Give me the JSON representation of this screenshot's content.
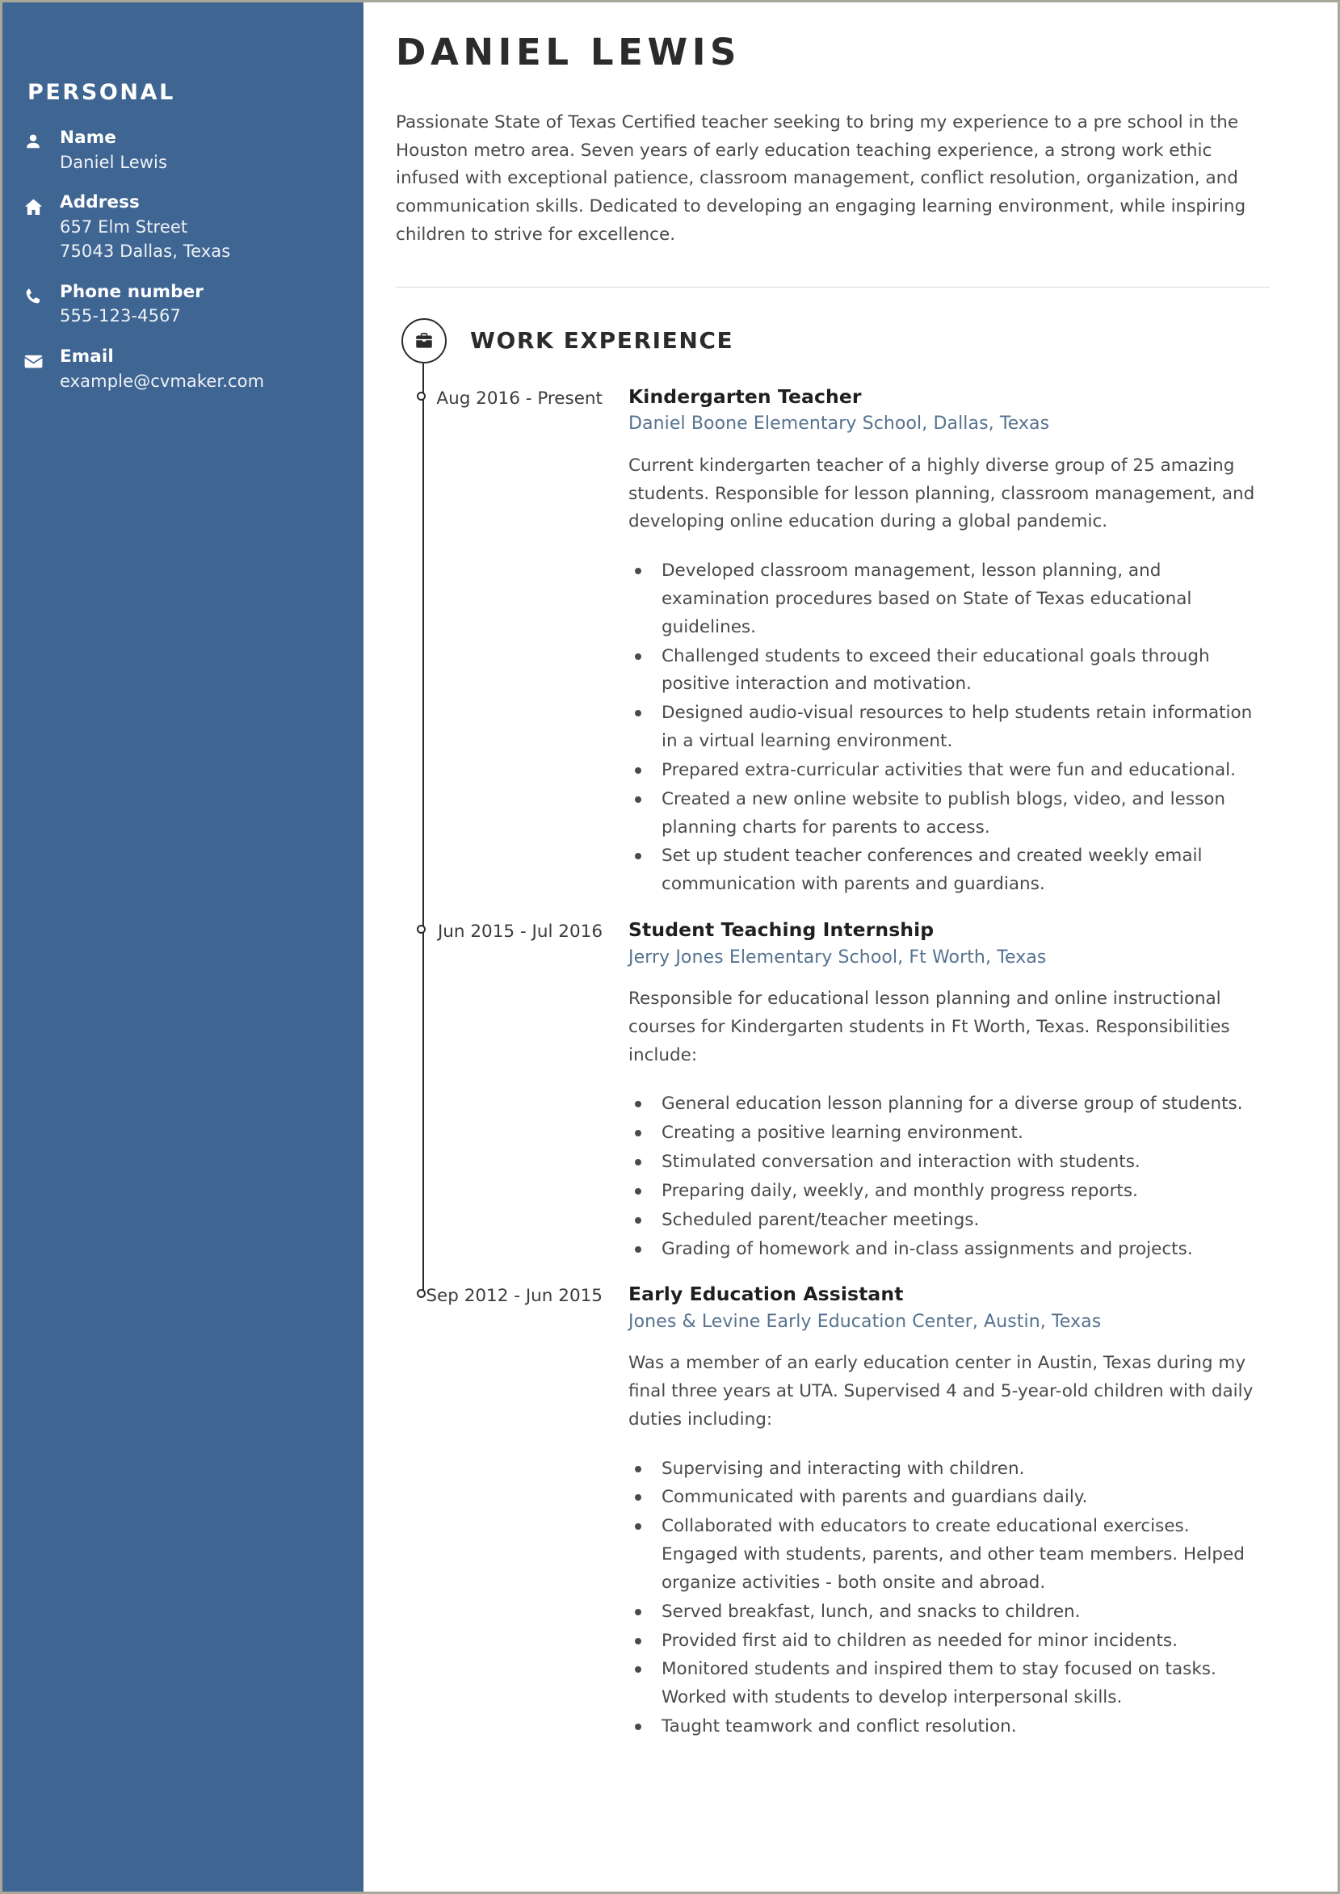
{
  "theme": {
    "sidebar_bg": "#3f6593",
    "accent_org": "#56738f",
    "text": "#4a4a4a",
    "heading": "#2b2b2b",
    "divider": "#d9d9d9"
  },
  "sidebar": {
    "heading": "PERSONAL",
    "items": [
      {
        "icon": "person-icon",
        "label": "Name",
        "values": [
          "Daniel Lewis"
        ]
      },
      {
        "icon": "home-icon",
        "label": "Address",
        "values": [
          "657 Elm Street",
          "75043 Dallas, Texas"
        ]
      },
      {
        "icon": "phone-icon",
        "label": "Phone number",
        "values": [
          "555-123-4567"
        ]
      },
      {
        "icon": "envelope-icon",
        "label": "Email",
        "values": [
          "example@cvmaker.com"
        ]
      }
    ]
  },
  "header": {
    "name": "DANIEL LEWIS",
    "summary": "Passionate State of Texas Certified teacher seeking to bring my experience to a pre school in the Houston metro area. Seven years of early education teaching experience, a strong work ethic infused with exceptional patience, classroom management, conflict resolution, organization, and communication skills. Dedicated to developing an engaging learning environment, while inspiring children to strive for excellence."
  },
  "work_experience": {
    "icon": "briefcase-icon",
    "title": "WORK EXPERIENCE",
    "entries": [
      {
        "date": "Aug 2016 - Present",
        "role": "Kindergarten Teacher",
        "organization": "Daniel Boone Elementary School, Dallas, Texas",
        "description": "Current kindergarten teacher of a highly diverse group of 25 amazing students. Responsible for lesson planning, classroom management, and developing online education during a global pandemic.",
        "bullets": [
          "Developed classroom management, lesson planning, and examination procedures based on State of Texas educational guidelines.",
          "Challenged students to exceed their educational goals through positive interaction and motivation.",
          "Designed audio-visual resources to help students retain information in a virtual learning environment.",
          "Prepared extra-curricular activities that were fun and educational.",
          "Created a new online website to publish blogs, video, and lesson planning charts for parents to access.",
          "Set up student teacher conferences and created weekly email communication with parents and guardians."
        ]
      },
      {
        "date": "Jun 2015 - Jul 2016",
        "role": "Student Teaching Internship",
        "organization": "Jerry Jones Elementary School, Ft Worth, Texas",
        "description": "Responsible for educational lesson planning and online instructional courses for Kindergarten students in Ft Worth, Texas. Responsibilities include:",
        "bullets": [
          "General education lesson planning for a diverse group of students.",
          "Creating a positive learning environment.",
          "Stimulated conversation and interaction with students.",
          "Preparing daily, weekly, and monthly progress reports.",
          "Scheduled parent/teacher meetings.",
          "Grading of homework and in-class assignments and projects."
        ]
      },
      {
        "date": "Sep 2012 - Jun 2015",
        "role": "Early Education Assistant",
        "organization": "Jones & Levine Early Education Center, Austin, Texas",
        "description": "Was a member of an early education center in Austin, Texas during my final three years at UTA. Supervised 4 and 5-year-old children with daily duties including:",
        "bullets": [
          "Supervising and interacting with children.",
          "Communicated with parents and guardians daily.",
          "Collaborated with educators to create educational exercises. Engaged with students, parents, and other team members. Helped organize activities - both onsite and abroad.",
          "Served breakfast, lunch, and snacks to children.",
          "Provided first aid to children as needed for minor incidents.",
          "Monitored students and inspired them to stay focused on tasks. Worked with students to develop interpersonal skills.",
          "Taught teamwork and conflict resolution."
        ]
      }
    ]
  }
}
